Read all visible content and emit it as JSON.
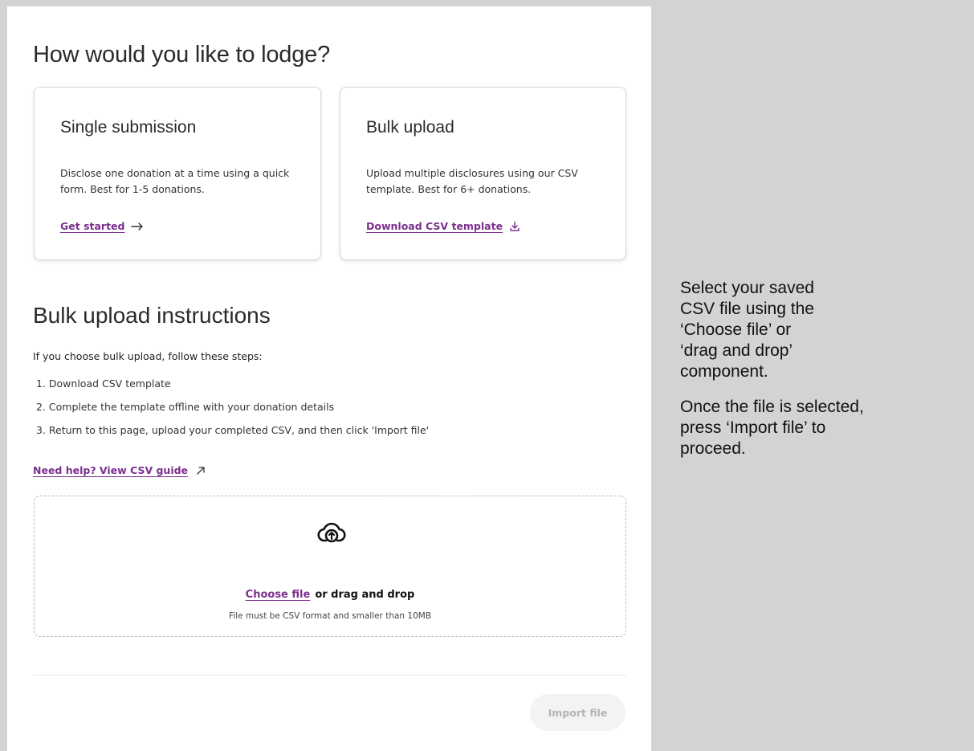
{
  "page": {
    "title": "How would you like to lodge?"
  },
  "cards": [
    {
      "title": "Single submission",
      "description": "Disclose one donation at a time using a quick form. Best for 1-5 donations.",
      "link_label": "Get started",
      "link_icon": "arrow-right-icon"
    },
    {
      "title": "Bulk upload",
      "description": "Upload multiple disclosures using our CSV template. Best for 6+ donations.",
      "link_label": "Download CSV template",
      "link_icon": "download-icon"
    }
  ],
  "instructions": {
    "title": "Bulk upload instructions",
    "intro": "If you choose bulk upload, follow these steps:",
    "steps": [
      "1. Download CSV template",
      "2. Complete the template offline with your donation details",
      "3. Return to this page, upload your completed CSV, and then click 'Import file'"
    ],
    "help_link": "Need help? View CSV guide",
    "help_icon": "external-link-icon"
  },
  "dropzone": {
    "icon": "cloud-upload-icon",
    "choose_label": "Choose file",
    "drag_label": "or drag and drop",
    "hint": "File must be CSV format and smaller than 10MB"
  },
  "footer": {
    "import_label": "Import file",
    "import_disabled": true
  },
  "annotation": {
    "para1": "Select your saved\nCSV file using the\n‘Choose file’ or\n‘drag  and drop’\ncomponent.",
    "para2": "Once the file is selected,\npress ‘Import file’ to\nproceed."
  },
  "colors": {
    "link": "#7b2f8e",
    "background": "#d3d3d5",
    "panel": "#ffffff"
  }
}
